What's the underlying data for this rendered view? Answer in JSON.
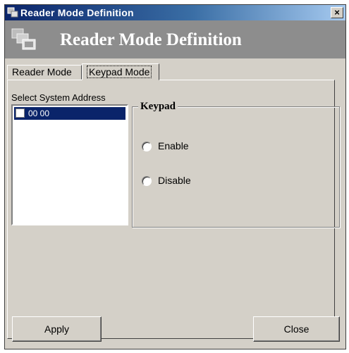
{
  "window": {
    "title": "Reader Mode Definition",
    "close_glyph": "×"
  },
  "banner": {
    "title": "Reader Mode Definition",
    "icon": "computers-icon"
  },
  "tabs": [
    {
      "label": "Reader Mode",
      "active": false
    },
    {
      "label": "Keypad Mode",
      "active": true
    }
  ],
  "system_address": {
    "label": "Select System Address",
    "items": [
      {
        "label": "00 00",
        "checked": false,
        "selected": true
      }
    ]
  },
  "keypad": {
    "title": "Keypad",
    "options": [
      {
        "label": "Enable",
        "selected": false
      },
      {
        "label": "Disable",
        "selected": false
      }
    ]
  },
  "buttons": {
    "apply": "Apply",
    "close": "Close"
  },
  "colors": {
    "titlebar": "#0a246a",
    "banner": "#8d8d8d",
    "face": "#d4d0c8",
    "selection": "#0a246a"
  }
}
